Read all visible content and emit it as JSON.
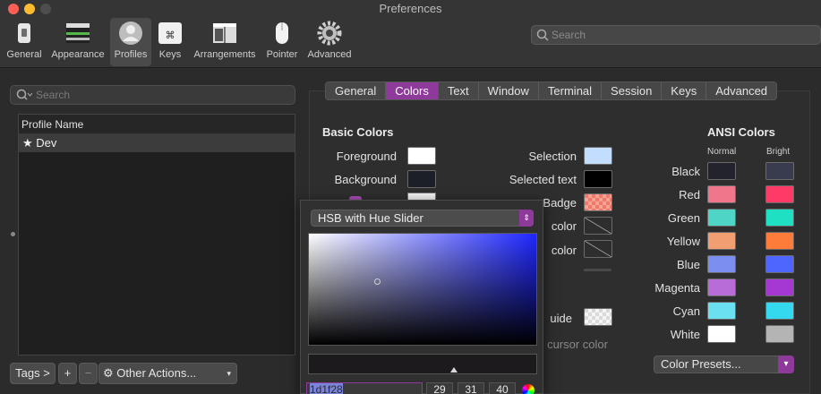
{
  "window": {
    "title": "Preferences"
  },
  "toolbar": {
    "items": [
      {
        "label": "General",
        "icon": "switch-icon"
      },
      {
        "label": "Appearance",
        "icon": "window-icon"
      },
      {
        "label": "Profiles",
        "icon": "person-icon",
        "selected": true
      },
      {
        "label": "Keys",
        "icon": "command-key-icon"
      },
      {
        "label": "Arrangements",
        "icon": "layout-icon"
      },
      {
        "label": "Pointer",
        "icon": "mouse-icon"
      },
      {
        "label": "Advanced",
        "icon": "gear-icon"
      }
    ],
    "search_placeholder": "Search"
  },
  "profiles": {
    "search_placeholder": "Search",
    "column_header": "Profile Name",
    "rows": [
      {
        "name": "Dev",
        "default": true
      }
    ]
  },
  "bottom_buttons": {
    "tags": "Tags >",
    "add": "+",
    "remove": "−",
    "other_actions": "Other Actions..."
  },
  "tabs": [
    "General",
    "Colors",
    "Text",
    "Window",
    "Terminal",
    "Session",
    "Keys",
    "Advanced"
  ],
  "active_tab": "Colors",
  "basic_colors": {
    "title": "Basic Colors",
    "foreground": "Foreground",
    "background": "Background",
    "selection": "Selection",
    "selected_text": "Selected text",
    "badge": "Badge",
    "color1": "color",
    "color2": "color",
    "guide": "uide",
    "cursor_color": "cursor color"
  },
  "ansi": {
    "title": "ANSI Colors",
    "normal_header": "Normal",
    "bright_header": "Bright",
    "rows": [
      {
        "name": "Black",
        "normal": "#22232c",
        "bright": "#383c4e"
      },
      {
        "name": "Red",
        "normal": "#f0768b",
        "bright": "#fe3a67"
      },
      {
        "name": "Green",
        "normal": "#4ed5c5",
        "bright": "#1fe0c3"
      },
      {
        "name": "Yellow",
        "normal": "#f29e73",
        "bright": "#fd7c3a"
      },
      {
        "name": "Blue",
        "normal": "#7c8ef0",
        "bright": "#4e65fe"
      },
      {
        "name": "Magenta",
        "normal": "#b86cd8",
        "bright": "#a538d3"
      },
      {
        "name": "Cyan",
        "normal": "#6be0f0",
        "bright": "#34d9ef"
      },
      {
        "name": "White",
        "normal": "#ffffff",
        "bright": "#b4b4b4"
      }
    ],
    "presets_label": "Color Presets..."
  },
  "picker": {
    "mode": "HSB with Hue Slider",
    "hex": "1d1f28",
    "r": "29",
    "g": "31",
    "b": "40"
  },
  "colors": {
    "accent": "#8e3a9a",
    "foreground": "#ffffff",
    "background": "#1d1f28",
    "selection": "#c3ddff",
    "selected_text": "#000000"
  }
}
